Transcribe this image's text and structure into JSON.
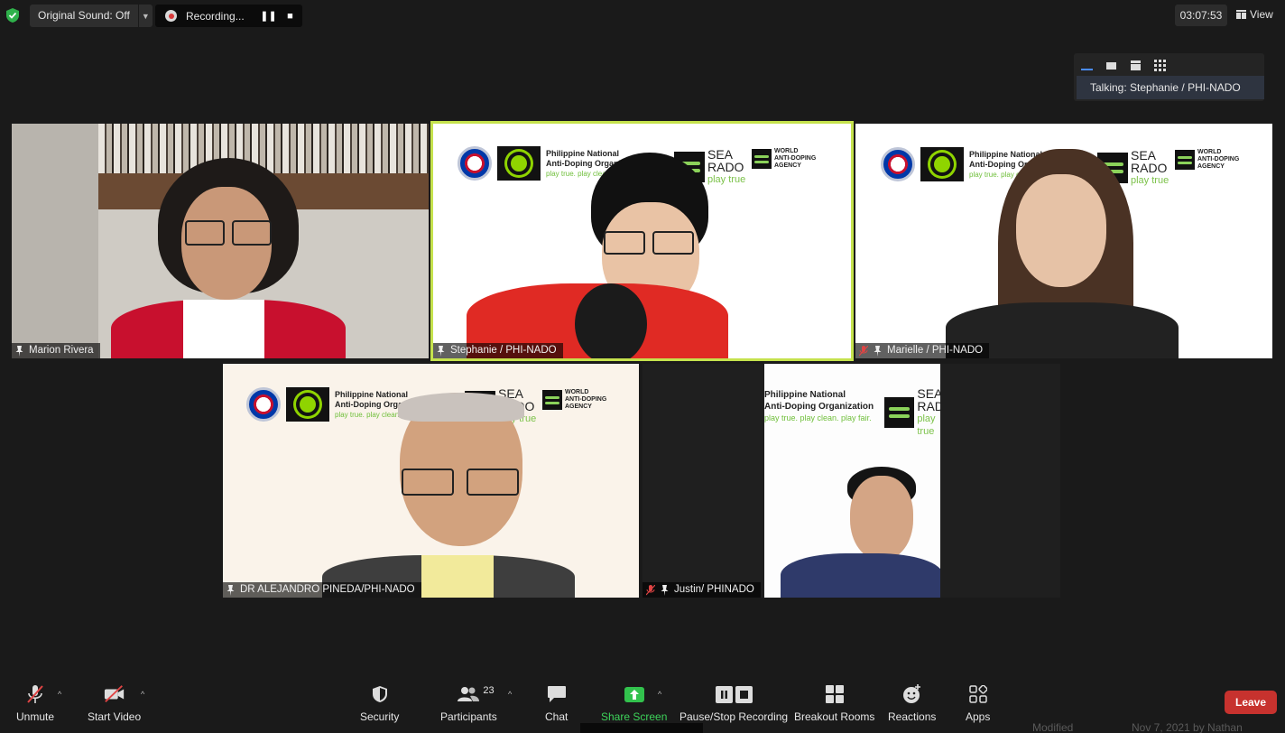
{
  "top_bar": {
    "original_sound_label": "Original Sound: Off",
    "recording_label": "Recording...",
    "timer": "03:07:53",
    "view_label": "View"
  },
  "speaker_popup": {
    "talking_label": "Talking: Stephanie / PHI-NADO"
  },
  "participants": [
    {
      "name": "Marion Rivera",
      "muted": false,
      "pinned": true
    },
    {
      "name": "Stephanie / PHI-NADO",
      "muted": false,
      "pinned": true,
      "active_speaker": true
    },
    {
      "name": "Marielle / PHI-NADO",
      "muted": true,
      "pinned": true
    },
    {
      "name": "DR ALEJANDRO PINEDA/PHI-NADO",
      "muted": false,
      "pinned": true
    },
    {
      "name": "Justin/ PHINADO",
      "muted": true,
      "pinned": true
    }
  ],
  "background_logos": {
    "org_line1": "Philippine National",
    "org_line2": "Anti-Doping Organization",
    "org_tagline": "play true. play clean. play fair.",
    "sea_line1": "SEA",
    "sea_line2": "RADO",
    "sea_tagline": "play true",
    "wada_line1": "WORLD",
    "wada_line2": "ANTI-DOPING",
    "wada_line3": "AGENCY",
    "wada_tagline": "play true"
  },
  "toolbar": {
    "unmute": "Unmute",
    "start_video": "Start Video",
    "security": "Security",
    "participants": "Participants",
    "participants_count": "23",
    "chat": "Chat",
    "share_screen": "Share Screen",
    "pause_stop_recording": "Pause/Stop Recording",
    "breakout_rooms": "Breakout Rooms",
    "reactions": "Reactions",
    "apps": "Apps",
    "leave": "Leave"
  },
  "behind_window": {
    "text_left": "Modified",
    "text_right": "Nov 7, 2021 by Nathan"
  },
  "colors": {
    "active_speaker_border": "#c5e24d",
    "share_green": "#32c24d",
    "leave_red": "#c7322e",
    "meeting_bg": "#1a1a1a"
  }
}
